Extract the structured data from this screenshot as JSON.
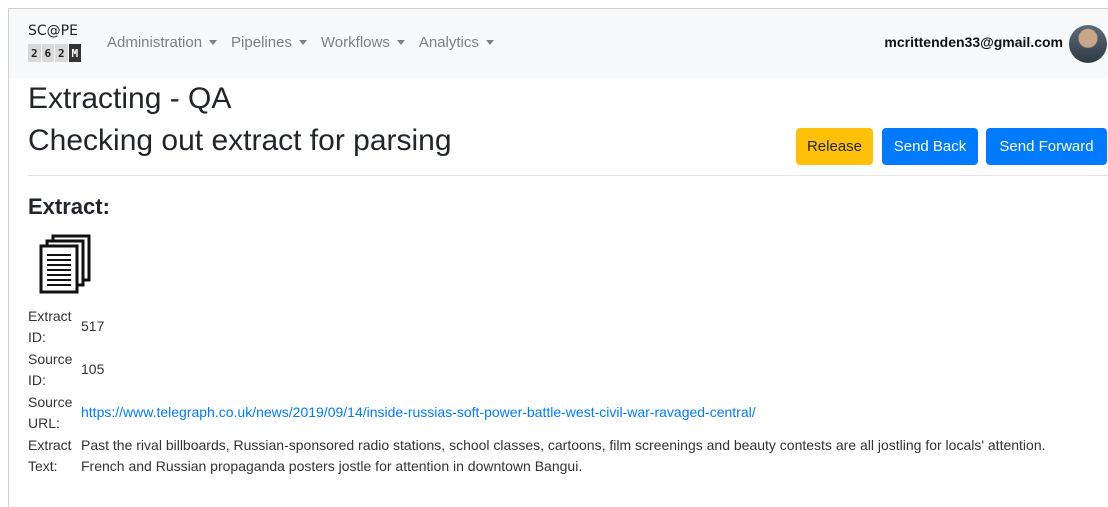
{
  "navbar": {
    "logo": {
      "top": "SC@PE",
      "bottom": [
        "2",
        "6",
        "2",
        "M"
      ]
    },
    "menu": [
      {
        "label": "Administration"
      },
      {
        "label": "Pipelines"
      },
      {
        "label": "Workflows"
      },
      {
        "label": "Analytics"
      }
    ],
    "user_email": "mcrittenden33@gmail.com"
  },
  "header": {
    "title": "Extracting - QA",
    "subtitle": "Checking out extract for parsing"
  },
  "actions": {
    "release_label": "Release",
    "send_back_label": "Send Back",
    "send_forward_label": "Send Forward"
  },
  "extract": {
    "heading": "Extract:",
    "icon": "documents-icon",
    "fields": {
      "extract_id_label": [
        "Extract",
        "ID:"
      ],
      "extract_id": "517",
      "source_id_label": [
        "Source",
        "ID:"
      ],
      "source_id": "105",
      "source_url_label": [
        "Source",
        "URL:"
      ],
      "source_url": "https://www.telegraph.co.uk/news/2019/09/14/inside-russias-soft-power-battle-west-civil-war-ravaged-central/",
      "extract_text_label": [
        "Extract",
        "Text:"
      ],
      "extract_text": "Past the rival billboards, Russian-sponsored radio stations, school classes, cartoons, film screenings and beauty contests are all jostling for locals' attention. French and Russian propaganda posters jostle for attention in downtown Bangui."
    }
  },
  "colors": {
    "primary": "#007bff",
    "warning": "#ffc107",
    "navbar_bg": "#f8f9fa"
  }
}
